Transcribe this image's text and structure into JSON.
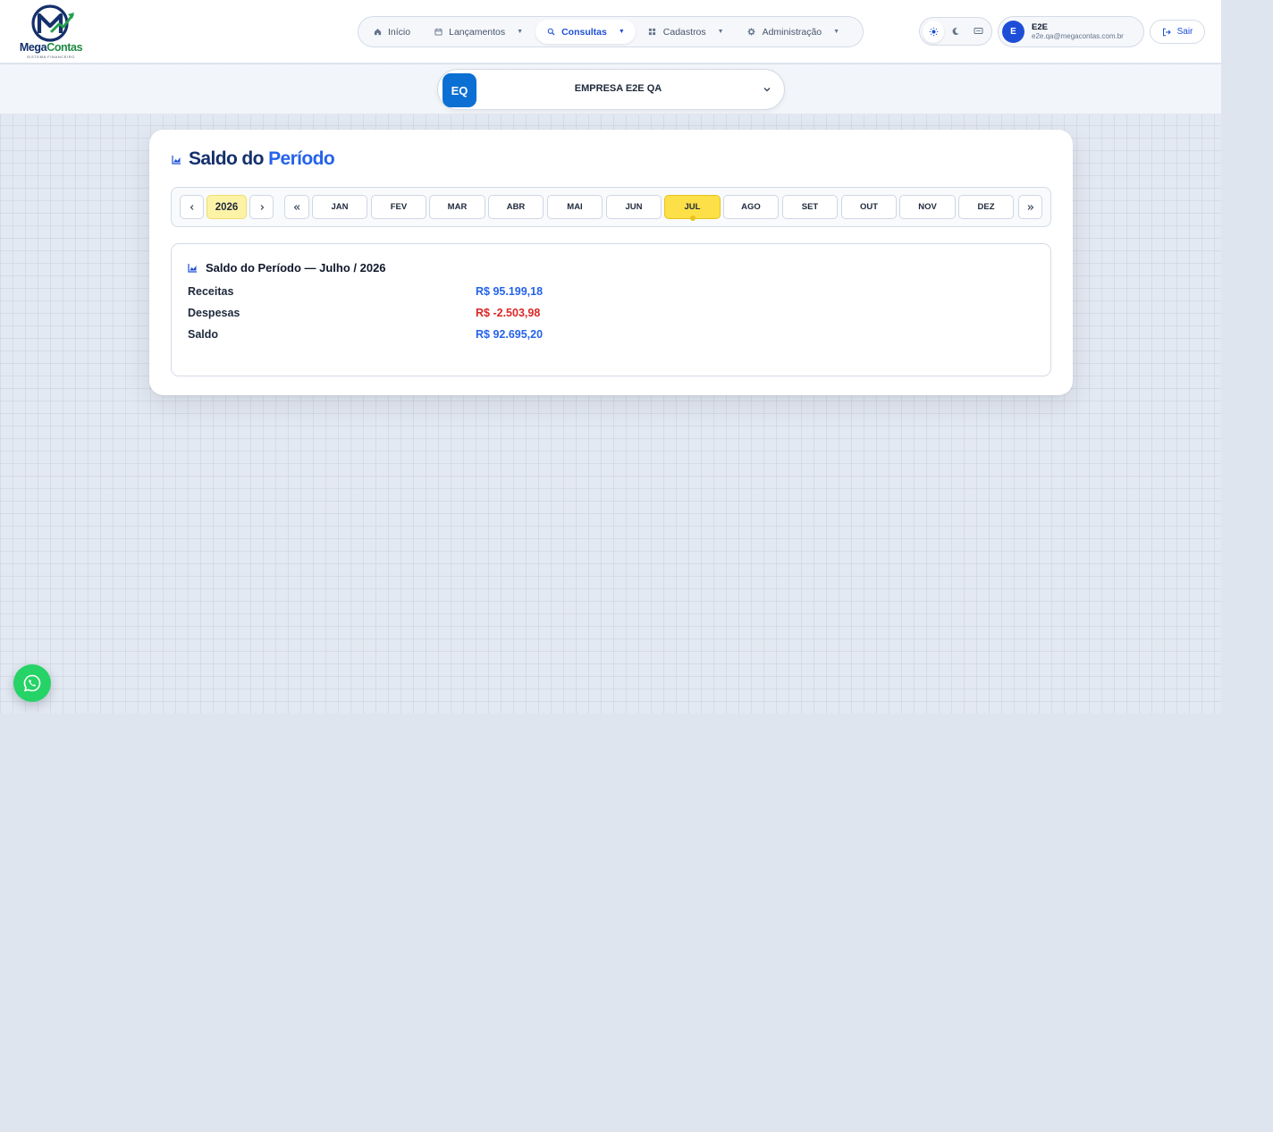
{
  "brand": {
    "name_part1": "Mega",
    "name_part2": "Contas",
    "tagline": "SISTEMA FINANCEIRO",
    "logo_icon": "megacontas-logo",
    "colors": {
      "navy": "#14306b",
      "green": "#1f8a43"
    }
  },
  "nav": {
    "items": [
      {
        "label": "Início",
        "icon": "home-icon",
        "dropdown": false,
        "active": false
      },
      {
        "label": "Lançamentos",
        "icon": "calendar-icon",
        "dropdown": true,
        "active": false
      },
      {
        "label": "Consultas",
        "icon": "search-icon",
        "dropdown": true,
        "active": true
      },
      {
        "label": "Cadastros",
        "icon": "grid-icon",
        "dropdown": true,
        "active": false
      },
      {
        "label": "Administração",
        "icon": "gear-icon",
        "dropdown": true,
        "active": false
      }
    ]
  },
  "theme_toggle": {
    "options": [
      "sun-icon",
      "moon-icon",
      "monitor-icon"
    ],
    "selected": "sun-icon"
  },
  "user": {
    "initial": "E",
    "name": "E2E",
    "email": "e2e.qa@megacontas.com.br"
  },
  "logout": {
    "label": "Sair",
    "icon": "logout-icon"
  },
  "company": {
    "badge": "EQ",
    "name": "EMPRESA E2E QA",
    "badge_color": "#0b6fd4"
  },
  "page": {
    "title_part1": "Saldo do",
    "title_part2": "Período",
    "icon": "chart-icon"
  },
  "period": {
    "year": "2026",
    "prev_year_icon": "chevron-left-icon",
    "next_year_icon": "chevron-right-icon",
    "prev_month_icon": "double-chevron-left-icon",
    "next_month_icon": "double-chevron-right-icon",
    "months": [
      "JAN",
      "FEV",
      "MAR",
      "ABR",
      "MAI",
      "JUN",
      "JUL",
      "AGO",
      "SET",
      "OUT",
      "NOV",
      "DEZ"
    ],
    "selected_month": "JUL",
    "highlight_color": "#fde047"
  },
  "summary": {
    "title": "Saldo do Período — Julho / 2026",
    "rows": [
      {
        "label": "Receitas",
        "value": "R$ 95.199,18",
        "tone": "blue"
      },
      {
        "label": "Despesas",
        "value": "R$ -2.503,98",
        "tone": "red"
      },
      {
        "label": "Saldo",
        "value": "R$ 92.695,20",
        "tone": "blue"
      }
    ],
    "colors": {
      "positive": "#2563eb",
      "negative": "#dc2626"
    }
  },
  "whatsapp": {
    "icon": "whatsapp-icon",
    "color": "#25d366"
  }
}
